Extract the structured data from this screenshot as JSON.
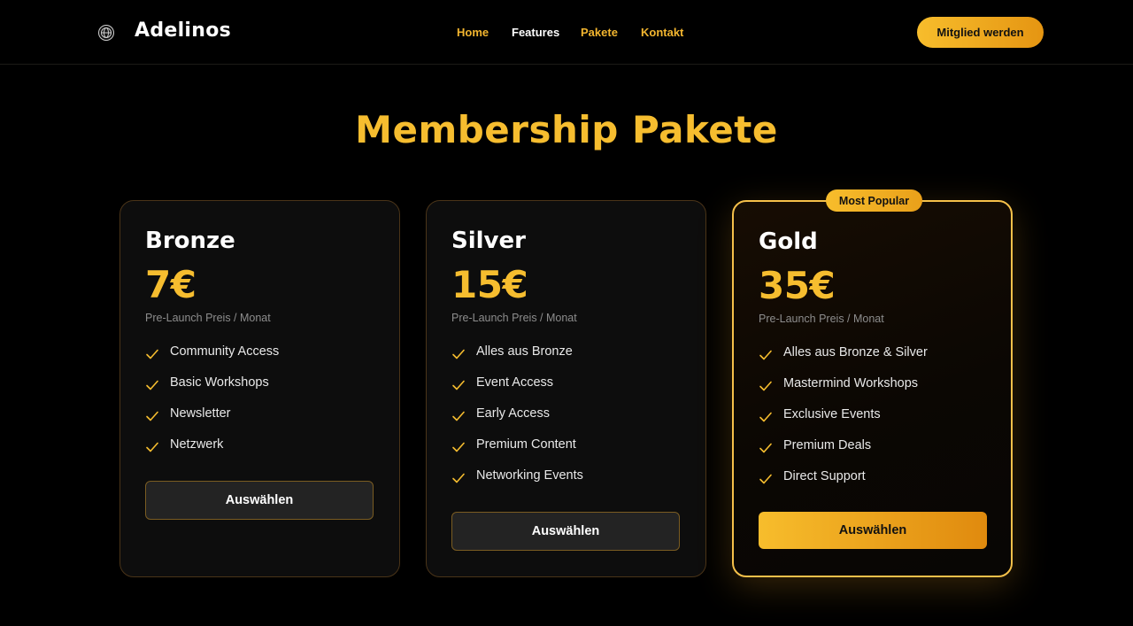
{
  "header": {
    "brand": "Adelinos",
    "nav": [
      {
        "label": "Home"
      },
      {
        "label": "Features"
      },
      {
        "label": "Pakete"
      },
      {
        "label": "Kontakt"
      }
    ],
    "cta_label": "Mitglied werden"
  },
  "main": {
    "title": "Membership Pakete",
    "plans": [
      {
        "name": "Bronze",
        "price": "7€",
        "note": "Pre-Launch Preis / Monat",
        "features": [
          "Community Access",
          "Basic Workshops",
          "Newsletter",
          "Netzwerk"
        ],
        "button": "Auswählen"
      },
      {
        "name": "Silver",
        "price": "15€",
        "note": "Pre-Launch Preis / Monat",
        "features": [
          "Alles aus Bronze",
          "Event Access",
          "Early Access",
          "Premium Content",
          "Networking Events"
        ],
        "button": "Auswählen"
      },
      {
        "name": "Gold",
        "badge": "Most Popular",
        "price": "35€",
        "note": "Pre-Launch Preis / Monat",
        "features": [
          "Alles aus Bronze & Silver",
          "Mastermind Workshops",
          "Exclusive Events",
          "Premium Deals",
          "Direct Support"
        ],
        "button": "Auswählen"
      }
    ]
  },
  "colors": {
    "accent": "#f6bd2f",
    "accent_dark": "#e08a0e",
    "background": "#000000",
    "card": "#0d0d0d"
  },
  "icons": {
    "logo": "globe-icon",
    "feature": "check-icon"
  }
}
